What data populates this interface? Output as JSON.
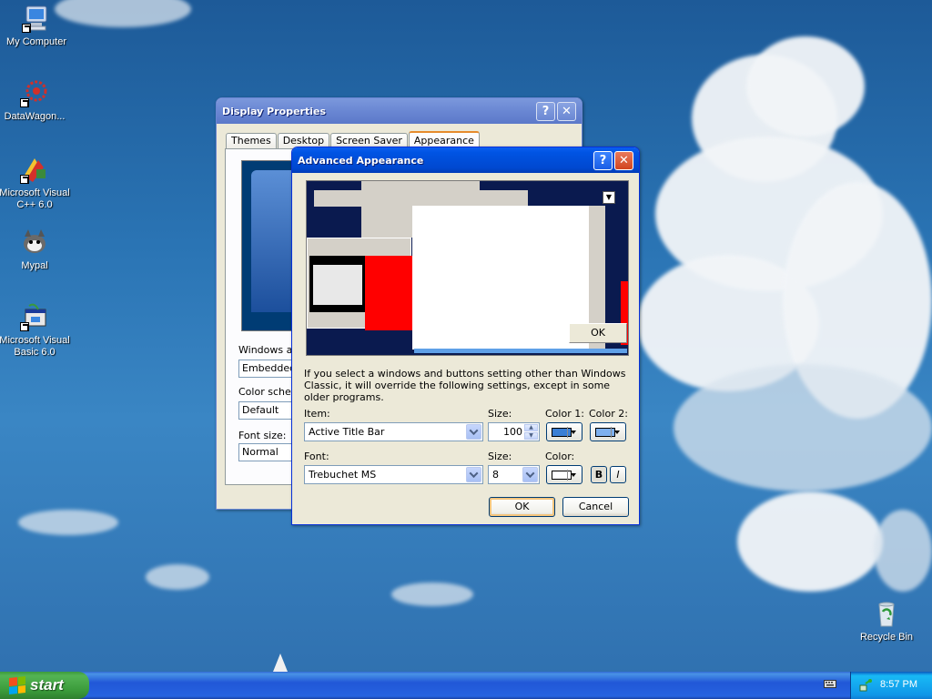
{
  "desktop": {
    "icons": [
      {
        "label": "My Computer"
      },
      {
        "label": "DataWagon..."
      },
      {
        "label": "Microsoft Visual C++ 6.0"
      },
      {
        "label": "Mypal"
      },
      {
        "label": "Microsoft Visual Basic 6.0"
      },
      {
        "label": "Recycle Bin"
      }
    ]
  },
  "display_properties": {
    "title": "Display Properties",
    "tabs": [
      "Themes",
      "Desktop",
      "Screen Saver",
      "Appearance"
    ],
    "selected_tab": "Appearance",
    "windows_buttons_label": "Windows and buttons:",
    "windows_buttons_value": "Embedded",
    "color_scheme_label": "Color scheme:",
    "color_scheme_value": "Default",
    "font_size_label": "Font size:",
    "font_size_value": "Normal"
  },
  "advanced_appearance": {
    "title": "Advanced Appearance",
    "preview_ok_label": "OK",
    "info_text": "If you select a windows and buttons setting other than Windows Classic, it will override the following settings, except in some older programs.",
    "item_label": "Item:",
    "item_value": "Active Title Bar",
    "size_label": "Size:",
    "size_value": "100",
    "color1_label": "Color 1:",
    "color2_label": "Color 2:",
    "color1_hex": "#3a7fd5",
    "color2_hex": "#7eb0ee",
    "font_label": "Font:",
    "font_value": "Trebuchet MS",
    "font_size_label": "Size:",
    "font_size_value": "8",
    "font_color_label": "Color:",
    "font_color_hex": "#ffffff",
    "bold_label": "B",
    "italic_label": "I",
    "ok_label": "OK",
    "cancel_label": "Cancel"
  },
  "taskbar": {
    "start_label": "start",
    "clock": "8:57 PM"
  },
  "colors": {
    "title_active": "#0054e3",
    "title_inactive": "#6a87d3",
    "dialog_bg": "#ece9d8",
    "start_green": "#3a9a3a"
  }
}
